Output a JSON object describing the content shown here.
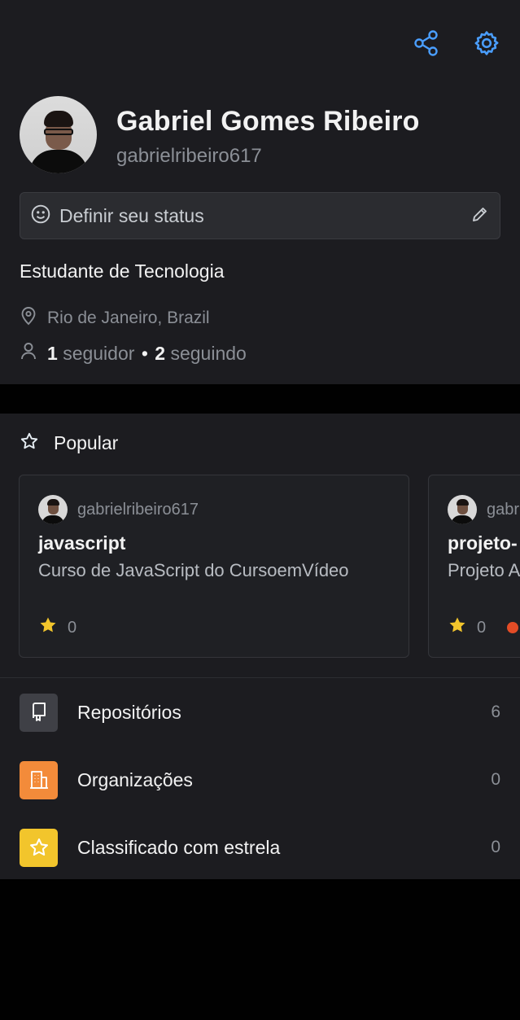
{
  "profile": {
    "name": "Gabriel Gomes Ribeiro",
    "login": "gabrielribeiro617",
    "status_placeholder": "Definir seu status",
    "bio": "Estudante de Tecnologia",
    "location": "Rio de Janeiro, Brazil",
    "followers_count": "1",
    "followers_label": "seguidor",
    "following_count": "2",
    "following_label": "seguindo",
    "separator": "•"
  },
  "header_icons": [
    "share-icon",
    "gear-icon"
  ],
  "popular": {
    "title": "Popular",
    "cards": [
      {
        "owner": "gabrielribeiro617",
        "repo": "javascript",
        "description": "Curso de JavaScript do CursoemVídeo",
        "stars": "0"
      },
      {
        "owner": "gabr",
        "repo": "projeto-",
        "description": "Projeto A",
        "stars": "0",
        "language_color": "#e34c26"
      }
    ]
  },
  "menu": [
    {
      "label": "Repositórios",
      "count": "6",
      "icon": "repo-icon",
      "color": "#3f4046"
    },
    {
      "label": "Organizações",
      "count": "0",
      "icon": "organization-icon",
      "color": "#f38b3a"
    },
    {
      "label": "Classificado com estrela",
      "count": "0",
      "icon": "star-icon",
      "color": "#f2c52c"
    }
  ],
  "colors": {
    "accent": "#4a9eff",
    "surface": "#1c1c20",
    "background": "#010101",
    "star": "#f2c52c"
  }
}
